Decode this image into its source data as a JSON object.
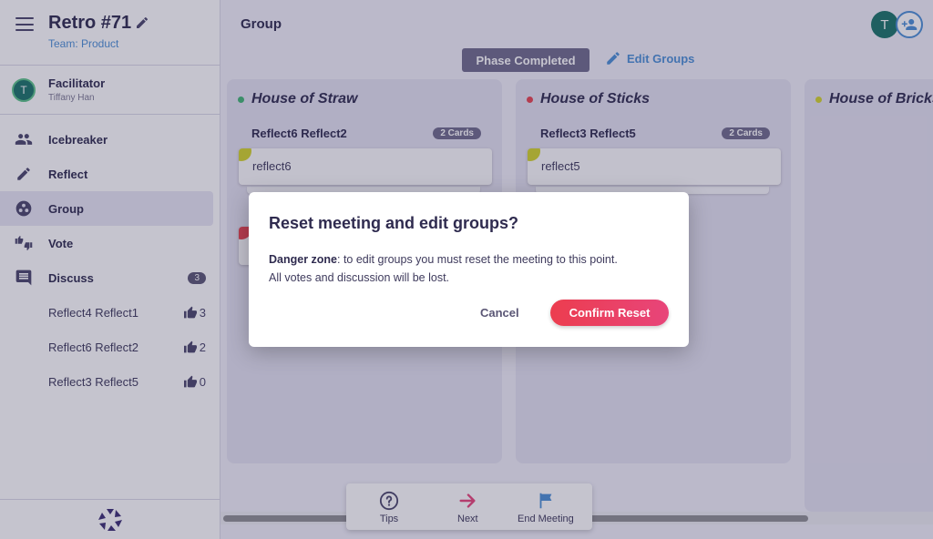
{
  "sidebar": {
    "meeting_title": "Retro #71",
    "team_link": "Team: Product",
    "facilitator": {
      "label": "Facilitator",
      "name": "Tiffany Han",
      "avatar_initial": "T"
    },
    "nav": [
      {
        "label": "Icebreaker",
        "icon": "people-icon"
      },
      {
        "label": "Reflect",
        "icon": "pencil-icon"
      },
      {
        "label": "Group",
        "icon": "group-icon",
        "active": true
      },
      {
        "label": "Vote",
        "icon": "thumbs-icon"
      },
      {
        "label": "Discuss",
        "icon": "chat-icon",
        "badge": "3"
      }
    ],
    "discuss_items": [
      {
        "label": "Reflect4 Reflect1",
        "votes": "3"
      },
      {
        "label": "Reflect6 Reflect2",
        "votes": "2"
      },
      {
        "label": "Reflect3 Reflect5",
        "votes": "0"
      }
    ]
  },
  "header": {
    "phase_title": "Group",
    "avatar_initial": "T",
    "phase_completed_label": "Phase Completed",
    "edit_groups_label": "Edit Groups"
  },
  "columns": [
    {
      "title": "House of Straw",
      "dot_color": "#40b574",
      "group": {
        "title": "Reflect6 Reflect2",
        "count": "2 Cards",
        "card_text": "reflect6"
      }
    },
    {
      "title": "House of Sticks",
      "dot_color": "#e8434f",
      "group": {
        "title": "Reflect3 Reflect5",
        "count": "2 Cards",
        "card_text": "reflect5"
      }
    },
    {
      "title": "House of Bricks",
      "dot_color": "#d3d42a"
    }
  ],
  "bottom_bar": {
    "tips": "Tips",
    "next": "Next",
    "end_meeting": "End Meeting"
  },
  "dialog": {
    "title": "Reset meeting and edit groups?",
    "danger_label": "Danger zone",
    "body_line1": ": to edit groups you must reset the meeting to this point.",
    "body_line2": "All votes and discussion will be lost.",
    "cancel": "Cancel",
    "confirm": "Confirm Reset"
  },
  "colors": {
    "accent_blue": "#4b8fd6",
    "danger_gradient_start": "#ec3d4f",
    "danger_gradient_end": "#e8457a",
    "next_arrow": "#e8457a",
    "brand_purple": "#3b2d73"
  }
}
